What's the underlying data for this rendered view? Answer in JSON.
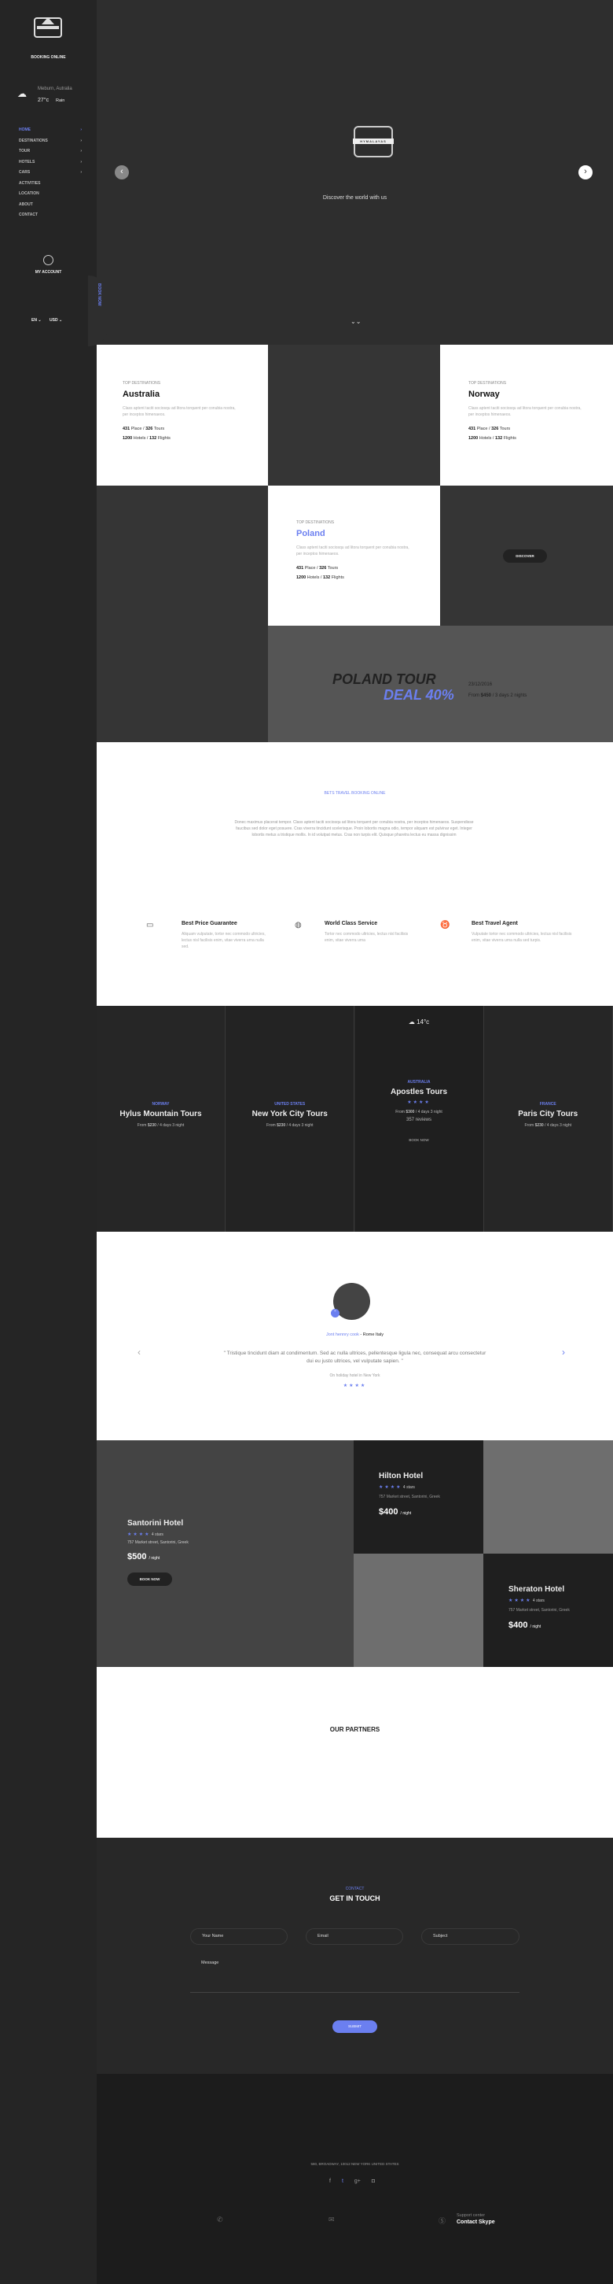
{
  "sidebar": {
    "logo": "HYMALAYAS",
    "tagline": "BOOKING ONLINE",
    "weather": {
      "location": "Meburn, Autralia",
      "temp": "27°c",
      "condition": "Rain",
      "icon": "cloud-rain-icon"
    },
    "nav": [
      {
        "label": "HOME",
        "active": true,
        "arrow": true
      },
      {
        "label": "DESTINATIONS",
        "arrow": true
      },
      {
        "label": "TOUR",
        "arrow": true
      },
      {
        "label": "HOTELS",
        "arrow": true
      },
      {
        "label": "CARS",
        "arrow": true
      },
      {
        "label": "ACTIVITIES"
      },
      {
        "label": "LOCATION"
      },
      {
        "label": "ABOUT"
      },
      {
        "label": "CONTACT"
      }
    ],
    "account": "MY ACCOUNT",
    "side_tab": "BOOK NOW",
    "lang": "EN",
    "currency": "USD"
  },
  "hero": {
    "logo": "HYMALAYAS",
    "subtitle": "Discover the world with us"
  },
  "destinations": [
    {
      "tag": "TOP DESTINATIONS",
      "name": "Australia",
      "desc": "Class aptent taciti sociosqu ad litora torquent per conubia nostra, per inceptos himenaeos.",
      "s1n": "431",
      "s1": "Place",
      "s2n": "326",
      "s2": "Tours",
      "s3n": "1200",
      "s3": "Hotels",
      "s4n": "132",
      "s4": "Flights"
    },
    {
      "tag": "TOP DESTINATIONS",
      "name": "Norway",
      "desc": "Class aptent taciti sociosqu ad litora torquent per conubia nostra, per inceptos himenaeos.",
      "s1n": "431",
      "s1": "Place",
      "s2n": "326",
      "s2": "Tours",
      "s3n": "1200",
      "s3": "Hotels",
      "s4n": "132",
      "s4": "Flights"
    },
    {
      "tag": "TOP DESTINATIONS",
      "name": "Poland",
      "desc": "Class aptent taciti sociosqu ad litora torquent per conubia nostra, per inceptos himenaeos.",
      "s1n": "431",
      "s1": "Place",
      "s2n": "326",
      "s2": "Tours",
      "s3n": "1200",
      "s3": "Hotels",
      "s4n": "132",
      "s4": "Flights"
    }
  ],
  "discover_label": "DISCOVER",
  "promo": {
    "title": "POLAND TOUR",
    "deal": "DEAL 40%",
    "date": "23/12/2016",
    "from": "From",
    "price": "$450",
    "duration": "/ 3 days 2 nights"
  },
  "intro": {
    "kicker": "BETS TRAVEL BOOKING ONLINE",
    "text": "Donec maximus placerat tempor. Class aptent taciti sociosqu ad litora torquent per conubia nostra, per inceptos himenaeos. Suspendisse faucibus sed dolor eget posuere. Cras viverra tincidunt scelerisque. Proin lobortis magna odio, tempor aliquam est pulvinar eget. Integer lobortis metus a tristique mollis. In id volutpat metus. Cras non turpis elit. Quisque pharetra lectus eu massa dignissim"
  },
  "features": [
    {
      "icon": "ticket-icon",
      "title": "Best Price Guarantee",
      "text": "Aliquam vulputate, tortor nec commodo ultricies, lectus nisl facilisis enim, vitae viverra urna nulla sed."
    },
    {
      "icon": "globe-icon",
      "title": "World Class Service",
      "text": "Tortor nec commodo ultricies, lectus nisl facilisis enim, vitae viverra urna"
    },
    {
      "icon": "flip-flops-icon",
      "title": "Best Travel Agent",
      "text": "Vulputate tortor nec commodo ultricies, lectus nisl facilisis enim, vitae viverra urna nulla sed turpis."
    }
  ],
  "tours": [
    {
      "country": "NORWAY",
      "name": "Hylus Mountain Tours",
      "price": "$230",
      "duration": "/ 4 days 3 night"
    },
    {
      "country": "UNITED STATES",
      "name": "New York City Tours",
      "price": "$230",
      "duration": "/ 4 days 3 night"
    },
    {
      "country": "AUSTRALIA",
      "name": "Apostles Tours",
      "price": "$300",
      "duration": "/ 4 days 3 night",
      "reviews": "357 reviews",
      "book": "BOOK NOW",
      "weather": "14°c",
      "rating": 4
    },
    {
      "country": "FRANCE",
      "name": "Paris City Tours",
      "price": "$230",
      "duration": "/ 4 days 3 night"
    }
  ],
  "from_label": "From",
  "testimonial": {
    "name": "Jont hennry cook",
    "location": "- Rome Italy",
    "quote": "\" Tristique tincidunt diam at condimentum. Sed ac nulla ultrices, pellentesque ligula nec, consequat arcu consectetur dui eu justo ultrices, vel vulputate sapien. \"",
    "context": "On holiday hotel in New York",
    "rating": 4
  },
  "hotels": [
    {
      "name": "Santorini Hotel",
      "stars": "4 stars",
      "address": "757 Market street, Santorini, Greek",
      "price": "$500",
      "unit": "/ night",
      "book": "BOOK NOW"
    },
    {
      "name": "Hilton Hotel",
      "stars": "4 stars",
      "address": "757 Market street, Santorini, Greek",
      "price": "$400",
      "unit": "/ night"
    },
    {
      "name": "Sheraton Hotel",
      "stars": "4 stars",
      "address": "757 Market street, Santorini, Greek",
      "price": "$400",
      "unit": "/ night"
    }
  ],
  "partners": {
    "title": "OUR PARTNERS"
  },
  "contact": {
    "kicker": "CONTACT",
    "title": "GET IN TOUCH",
    "name_ph": "Your Name",
    "email_ph": "Email",
    "subject_ph": "Subject",
    "message_ph": "Message",
    "submit": "SUBMIT"
  },
  "footer": {
    "address": "580, BROADWAY, 10012 NEW YORK UNITED STATES",
    "support_label": "Support center",
    "support_value": "Contact Skype"
  },
  "colors": {
    "accent": "#6b7ff0",
    "dark": "#252525",
    "footer": "#1c1c1c"
  }
}
